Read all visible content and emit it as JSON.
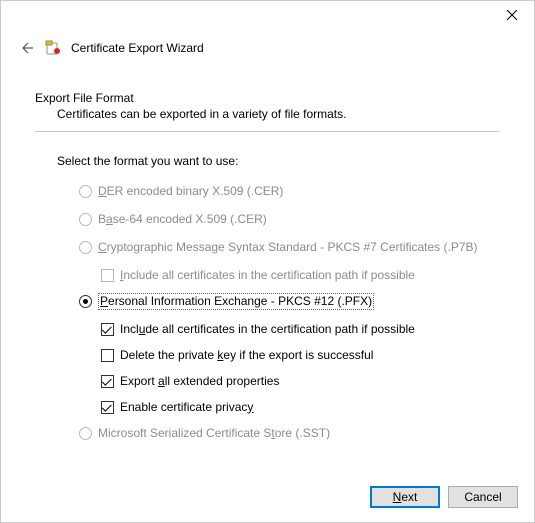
{
  "window": {
    "title": "Certificate Export Wizard"
  },
  "section": {
    "title": "Export File Format",
    "subtitle": "Certificates can be exported in a variety of file formats."
  },
  "prompt": "Select the format you want to use:",
  "options": {
    "der": {
      "pre": "",
      "u": "D",
      "post": "ER encoded binary X.509 (.CER)"
    },
    "base64": {
      "pre": "B",
      "u": "a",
      "post": "se-64 encoded X.509 (.CER)"
    },
    "pkcs7": {
      "pre": "",
      "u": "C",
      "post": "ryptographic Message Syntax Standard - PKCS #7 Certificates (.P7B)"
    },
    "pkcs7_inc": {
      "pre": "",
      "u": "I",
      "post": "nclude all certificates in the certification path if possible"
    },
    "pfx": {
      "pre": "",
      "u": "P",
      "post": "ersonal Information Exchange - PKCS #12 (.PFX)"
    },
    "pfx_inc": {
      "pre": "Incl",
      "u": "u",
      "post": "de all certificates in the certification path if possible"
    },
    "pfx_del": {
      "pre": "Delete the private ",
      "u": "k",
      "post": "ey if the export is successful"
    },
    "pfx_ext": {
      "pre": "Export ",
      "u": "a",
      "post": "ll extended properties"
    },
    "pfx_priv": {
      "pre": "Enable certificate privac",
      "u": "y",
      "post": ""
    },
    "sst": {
      "pre": "Microsoft Serialized Certificate S",
      "u": "t",
      "post": "ore (.SST)"
    }
  },
  "buttons": {
    "next": {
      "u": "N",
      "post": "ext"
    },
    "cancel": "Cancel"
  }
}
